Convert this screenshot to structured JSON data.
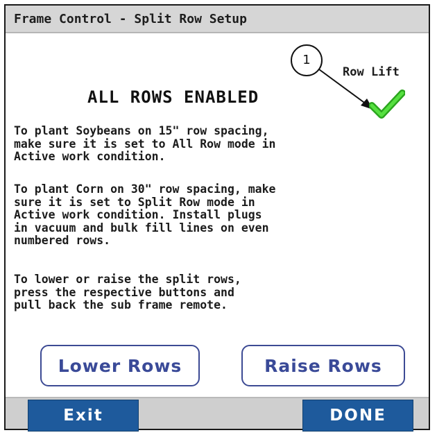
{
  "window": {
    "title": "Frame Control - Split Row Setup"
  },
  "callout": {
    "number": "1"
  },
  "row_lift": {
    "label": "Row Lift",
    "icon": "check-icon",
    "color": "#3ecf2a"
  },
  "status": {
    "text": "ALL ROWS ENABLED"
  },
  "instructions": {
    "p1": "To plant Soybeans on 15\" row spacing,\nmake sure it is set to All Row mode in\nActive work condition.",
    "p2": "To plant Corn on 30\" row spacing, make\nsure it is set to Split Row mode in\nActive work condition. Install plugs\nin vacuum and bulk fill lines on even\nnumbered rows.",
    "p3": "To lower or raise the split rows,\npress the respective buttons and\npull back the sub frame remote."
  },
  "buttons": {
    "lower": "Lower Rows",
    "raise": "Raise Rows"
  },
  "footer": {
    "exit": "Exit",
    "done": "DONE"
  },
  "colors": {
    "button_outline": "#3c4a94",
    "nav_button": "#1e5a9c",
    "title_bar": "#d6d6d6"
  }
}
